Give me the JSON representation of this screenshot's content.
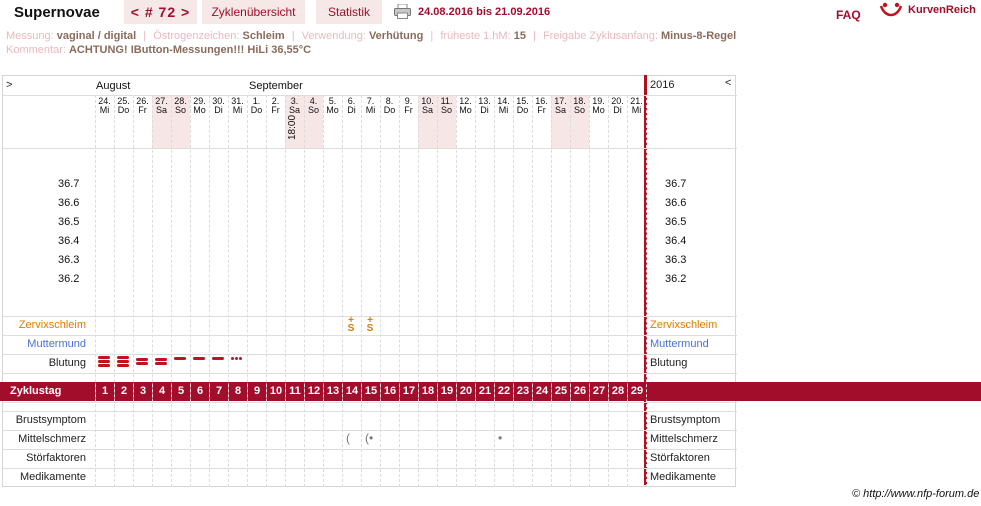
{
  "header": {
    "title": "Supernovae",
    "cycle_tab": "< # 72 >",
    "overview_tab": "Zyklenübersicht",
    "stats_tab": "Statistik",
    "date_range": "24.08.2016 bis 21.09.2016",
    "faq": "FAQ",
    "brand": "KurvenReich"
  },
  "meta": {
    "messung_label": "Messung:",
    "messung_value": "vaginal / digital",
    "oestrogen_label": "Östrogenzeichen:",
    "oestrogen_value": "Schleim",
    "verwendung_label": "Verwendung:",
    "verwendung_value": "Verhütung",
    "frueheste_label": "früheste 1.hM:",
    "frueheste_value": "15",
    "freigabe_label": "Freigabe Zyklusanfang:",
    "freigabe_value": "Minus-8-Regel",
    "kommentar_label": "Kommentar:",
    "kommentar_value": "ACHTUNG! IButton-Messungen!!! HiLi 36,55°C"
  },
  "chart": {
    "nav_left": ">",
    "nav_right": "<",
    "year": "2016",
    "months": [
      "August",
      "September"
    ],
    "days": [
      {
        "d": "24.",
        "w": "Mi"
      },
      {
        "d": "25.",
        "w": "Do"
      },
      {
        "d": "26.",
        "w": "Fr"
      },
      {
        "d": "27.",
        "w": "Sa"
      },
      {
        "d": "28.",
        "w": "So"
      },
      {
        "d": "29.",
        "w": "Mo"
      },
      {
        "d": "30.",
        "w": "Di"
      },
      {
        "d": "31.",
        "w": "Mi"
      },
      {
        "d": "1.",
        "w": "Do"
      },
      {
        "d": "2.",
        "w": "Fr"
      },
      {
        "d": "3.",
        "w": "Sa"
      },
      {
        "d": "4.",
        "w": "So"
      },
      {
        "d": "5.",
        "w": "Mo"
      },
      {
        "d": "6.",
        "w": "Di"
      },
      {
        "d": "7.",
        "w": "Mi"
      },
      {
        "d": "8.",
        "w": "Do"
      },
      {
        "d": "9.",
        "w": "Fr"
      },
      {
        "d": "10.",
        "w": "Sa"
      },
      {
        "d": "11.",
        "w": "So"
      },
      {
        "d": "12.",
        "w": "Mo"
      },
      {
        "d": "13.",
        "w": "Di"
      },
      {
        "d": "14.",
        "w": "Mi"
      },
      {
        "d": "15.",
        "w": "Do"
      },
      {
        "d": "16.",
        "w": "Fr"
      },
      {
        "d": "17.",
        "w": "Sa"
      },
      {
        "d": "18.",
        "w": "So"
      },
      {
        "d": "19.",
        "w": "Mo"
      },
      {
        "d": "20.",
        "w": "Di"
      },
      {
        "d": "21.",
        "w": "Mi"
      }
    ],
    "time_note": "18:00",
    "temp_ticks": [
      "36.7",
      "36.6",
      "36.5",
      "36.4",
      "36.3",
      "36.2"
    ],
    "rows": {
      "zervix": "Zervixschleim",
      "muttermund": "Muttermund",
      "blutung": "Blutung",
      "zyklustag": "Zyklustag",
      "brust": "Brustsymptom",
      "mittelschmerz": "Mittelschmerz",
      "stoer": "Störfaktoren",
      "medi": "Medikamente"
    },
    "cycle_days": [
      "1",
      "2",
      "3",
      "4",
      "5",
      "6",
      "7",
      "8",
      "9",
      "10",
      "11",
      "12",
      "13",
      "14",
      "15",
      "16",
      "17",
      "18",
      "19",
      "20",
      "21",
      "22",
      "23",
      "24",
      "25",
      "26",
      "27",
      "28",
      "29"
    ],
    "zervix_marks": [
      {
        "day": 14,
        "symbol": "S+"
      },
      {
        "day": 15,
        "symbol": "S+"
      }
    ],
    "bleeding": [
      3,
      3,
      2,
      2,
      1,
      1,
      1,
      0.5
    ],
    "mittelschmerz_marks": [
      {
        "day": 14,
        "symbol": "("
      },
      {
        "day": 15,
        "symbol": "(•"
      },
      {
        "day": 22,
        "symbol": "•"
      }
    ],
    "colors": {
      "accent": "#a30d2c",
      "zervix": "#e07b00",
      "muttermund": "#4a6fd6",
      "bleeding": "#c1131d"
    }
  },
  "footer": {
    "copyright": "© http://www.nfp-forum.de"
  }
}
